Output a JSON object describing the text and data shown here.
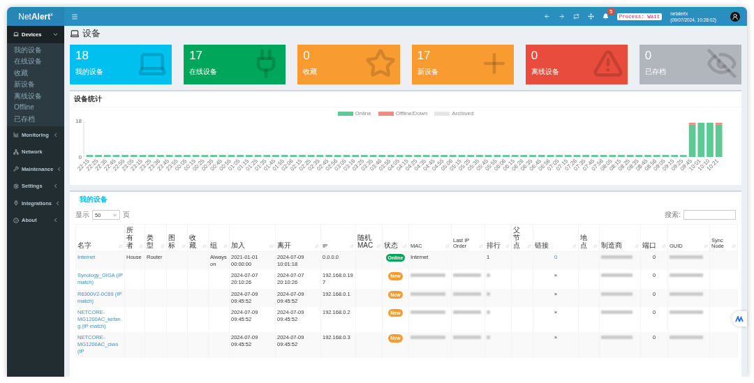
{
  "logo": "Net**Alert**$^{x}$",
  "navbar": {
    "notification_count": "5",
    "process": "Process: Wait",
    "user": "netalertx",
    "timestamp": "(09/07/2024, 10:28:02)"
  },
  "sidebar": {
    "items": [
      {
        "label": "Devices",
        "kind": "group",
        "expanded": true,
        "selected": true,
        "children": [
          {
            "label": "我的设备"
          },
          {
            "label": "在线设备"
          },
          {
            "label": "收藏"
          },
          {
            "label": "新设备"
          },
          {
            "label": "离线设备"
          },
          {
            "label": "Offline"
          },
          {
            "label": "已存档"
          }
        ]
      },
      {
        "label": "Monitoring",
        "kind": "group",
        "expanded": false,
        "selected": false
      },
      {
        "label": "Network",
        "kind": "link",
        "selected": false
      },
      {
        "label": "Maintenance",
        "kind": "group",
        "expanded": false,
        "selected": false
      },
      {
        "label": "Settings",
        "kind": "group",
        "expanded": false,
        "selected": false
      },
      {
        "label": "Integrations",
        "kind": "group",
        "expanded": false,
        "selected": false
      },
      {
        "label": "About",
        "kind": "group",
        "expanded": false,
        "selected": false
      }
    ]
  },
  "page_title": "设备",
  "stats": [
    {
      "count": "18",
      "label": "我的设备",
      "color": "#00c0ef"
    },
    {
      "count": "17",
      "label": "在线设备",
      "color": "#00a65a"
    },
    {
      "count": "0",
      "label": "收藏",
      "color": "#f89c32"
    },
    {
      "count": "17",
      "label": "新设备",
      "color": "#f89c32"
    },
    {
      "count": "0",
      "label": "离线设备",
      "color": "#e74c3c"
    },
    {
      "count": "0",
      "label": "已存档",
      "color": "#b1b5bc"
    }
  ],
  "chart_panel": {
    "title": "设备统计",
    "chart_data": {
      "type": "bar",
      "stacked": true,
      "legend": "top",
      "categories": [
        "22:15",
        "22:25",
        "22:35",
        "22:45",
        "22:55",
        "23:05",
        "23:15",
        "23:25",
        "23:36",
        "23:45",
        "23:55",
        "00:05",
        "00:15",
        "00:25",
        "00:35",
        "00:45",
        "00:55",
        "01:05",
        "01:15",
        "01:25",
        "01:35",
        "01:45",
        "01:55",
        "02:06",
        "02:15",
        "02:25",
        "02:35",
        "02:45",
        "02:56",
        "03:05",
        "03:16",
        "03:25",
        "03:35",
        "03:46",
        "03:55",
        "04:05",
        "04:15",
        "04:25",
        "04:35",
        "04:45",
        "04:55",
        "05:06",
        "05:15",
        "05:25",
        "05:35",
        "05:45",
        "05:55",
        "06:06",
        "06:15",
        "06:26",
        "06:35",
        "06:45",
        "06:56",
        "07:05",
        "07:15",
        "07:26",
        "07:35",
        "07:45",
        "07:56",
        "08:05",
        "08:15",
        "08:25",
        "08:35",
        "08:45",
        "08:56",
        "09:05",
        "09:15",
        "09:25",
        "09:45",
        "10:01",
        "10:10",
        "10:21"
      ],
      "series": [
        {
          "name": "Online",
          "color": "#5fc996",
          "values": [
            1,
            1,
            1,
            1,
            1,
            1,
            1,
            1,
            1,
            1,
            1,
            1,
            1,
            1,
            1,
            1,
            1,
            1,
            1,
            1,
            1,
            1,
            1,
            1,
            1,
            1,
            1,
            1,
            1,
            1,
            1,
            1,
            1,
            1,
            1,
            1,
            1,
            1,
            1,
            1,
            1,
            1,
            1,
            1,
            1,
            1,
            1,
            1,
            1,
            1,
            1,
            1,
            1,
            1,
            1,
            1,
            1,
            1,
            1,
            1,
            1,
            1,
            1,
            1,
            1,
            1,
            1,
            1,
            16,
            17,
            17,
            16
          ]
        },
        {
          "name": "Offline/Down",
          "color": "#f08a85",
          "values": [
            0,
            0,
            0,
            0,
            0,
            0,
            0,
            0,
            0,
            0,
            0,
            0,
            0,
            0,
            0,
            0,
            0,
            0,
            0,
            0,
            0,
            0,
            0,
            0,
            0,
            0,
            0,
            0,
            0,
            0,
            0,
            0,
            0,
            0,
            0,
            0,
            0,
            0,
            0,
            0,
            0,
            0,
            0,
            0,
            0,
            0,
            0,
            0,
            0,
            0,
            0,
            0,
            0,
            0,
            0,
            0,
            0,
            0,
            0,
            0,
            0,
            0,
            0,
            0,
            0,
            0,
            0,
            0,
            1,
            0,
            0,
            1
          ]
        },
        {
          "name": "Archived",
          "color": "#e6e6e6",
          "values": [
            0,
            0,
            0,
            0,
            0,
            0,
            0,
            0,
            0,
            0,
            0,
            0,
            0,
            0,
            0,
            0,
            0,
            0,
            0,
            0,
            0,
            0,
            0,
            0,
            0,
            0,
            0,
            0,
            0,
            0,
            0,
            0,
            0,
            0,
            0,
            0,
            0,
            0,
            0,
            0,
            0,
            0,
            0,
            0,
            0,
            0,
            0,
            0,
            0,
            0,
            0,
            0,
            0,
            0,
            0,
            0,
            0,
            0,
            0,
            0,
            0,
            0,
            0,
            0,
            0,
            0,
            0,
            0,
            0,
            0,
            0,
            0
          ]
        }
      ],
      "ylim": [
        0,
        18
      ],
      "yticks": [
        0,
        18
      ]
    }
  },
  "devices_panel": {
    "title": "我的设备",
    "show_label": "显示",
    "page_size": "50",
    "page_label": "页",
    "search_label": "搜索:",
    "columns": [
      "名字",
      "所有者",
      "类型",
      "图标",
      "收藏",
      "组",
      "加入",
      "离开",
      "IP",
      "随机 MAC",
      "状态",
      "MAC",
      "Last IP Order",
      "排行",
      "父节点",
      "链接",
      "地点",
      "制造商",
      "端口",
      "GUID",
      "Sync Node"
    ],
    "rows": [
      {
        "name": "Internet",
        "owner": "House",
        "type": "Router",
        "group": "Always on",
        "joined": "2021-01-01 00:00:00",
        "left": "2024-07-09 10:01:18",
        "ip": "0.0.0.0",
        "status": {
          "label": "Online",
          "color": "#00a65a"
        },
        "mac": "Internet",
        "rank": "1",
        "link": "0",
        "linked": true,
        "port": "0",
        "redacted": {
          "mac": false,
          "order": false,
          "rank": false,
          "maker": true,
          "guid": true
        }
      },
      {
        "name": "Synology_GIGA (IP match)",
        "joined": "2024-07-07 20:10:26",
        "left": "2024-07-07 20:10:26",
        "ip": "192.168.0.197",
        "status": {
          "label": "New",
          "color": "#f89c32"
        },
        "link": "×",
        "linked": false,
        "port": "0",
        "redacted": {
          "mac": true,
          "order": true,
          "rank": true,
          "maker": true,
          "guid": true
        }
      },
      {
        "name": "R6300V2-0C69 (IP match)",
        "joined": "2024-07-09 09:45:52",
        "left": "2024-07-09 09:45:52",
        "ip": "192.168.0.1",
        "status": {
          "label": "New",
          "color": "#f89c32"
        },
        "link": "×",
        "linked": false,
        "port": "0",
        "redacted": {
          "mac": true,
          "order": true,
          "rank": true,
          "maker": true,
          "guid": true
        }
      },
      {
        "name": "NETCORE-MG1200AC_kefang (IP match)",
        "joined": "2024-07-09 09:45:52",
        "left": "2024-07-09 09:45:52",
        "ip": "192.168.0.2",
        "status": {
          "label": "New",
          "color": "#f89c32"
        },
        "link": "×",
        "linked": false,
        "port": "0",
        "redacted": {
          "mac": true,
          "order": true,
          "rank": true,
          "maker": true,
          "guid": true
        }
      },
      {
        "name": "NETCORE-MG1200AC_ciwo (IP",
        "joined": "2024-07-09 09:45:52",
        "left": "2024-07-09 09:45:52",
        "ip": "192.168.0.3",
        "status": {
          "label": "New",
          "color": "#f89c32"
        },
        "link": "×",
        "linked": false,
        "port": "0",
        "redacted": {
          "mac": true,
          "order": true,
          "rank": true,
          "maker": true,
          "guid": true
        }
      }
    ]
  }
}
